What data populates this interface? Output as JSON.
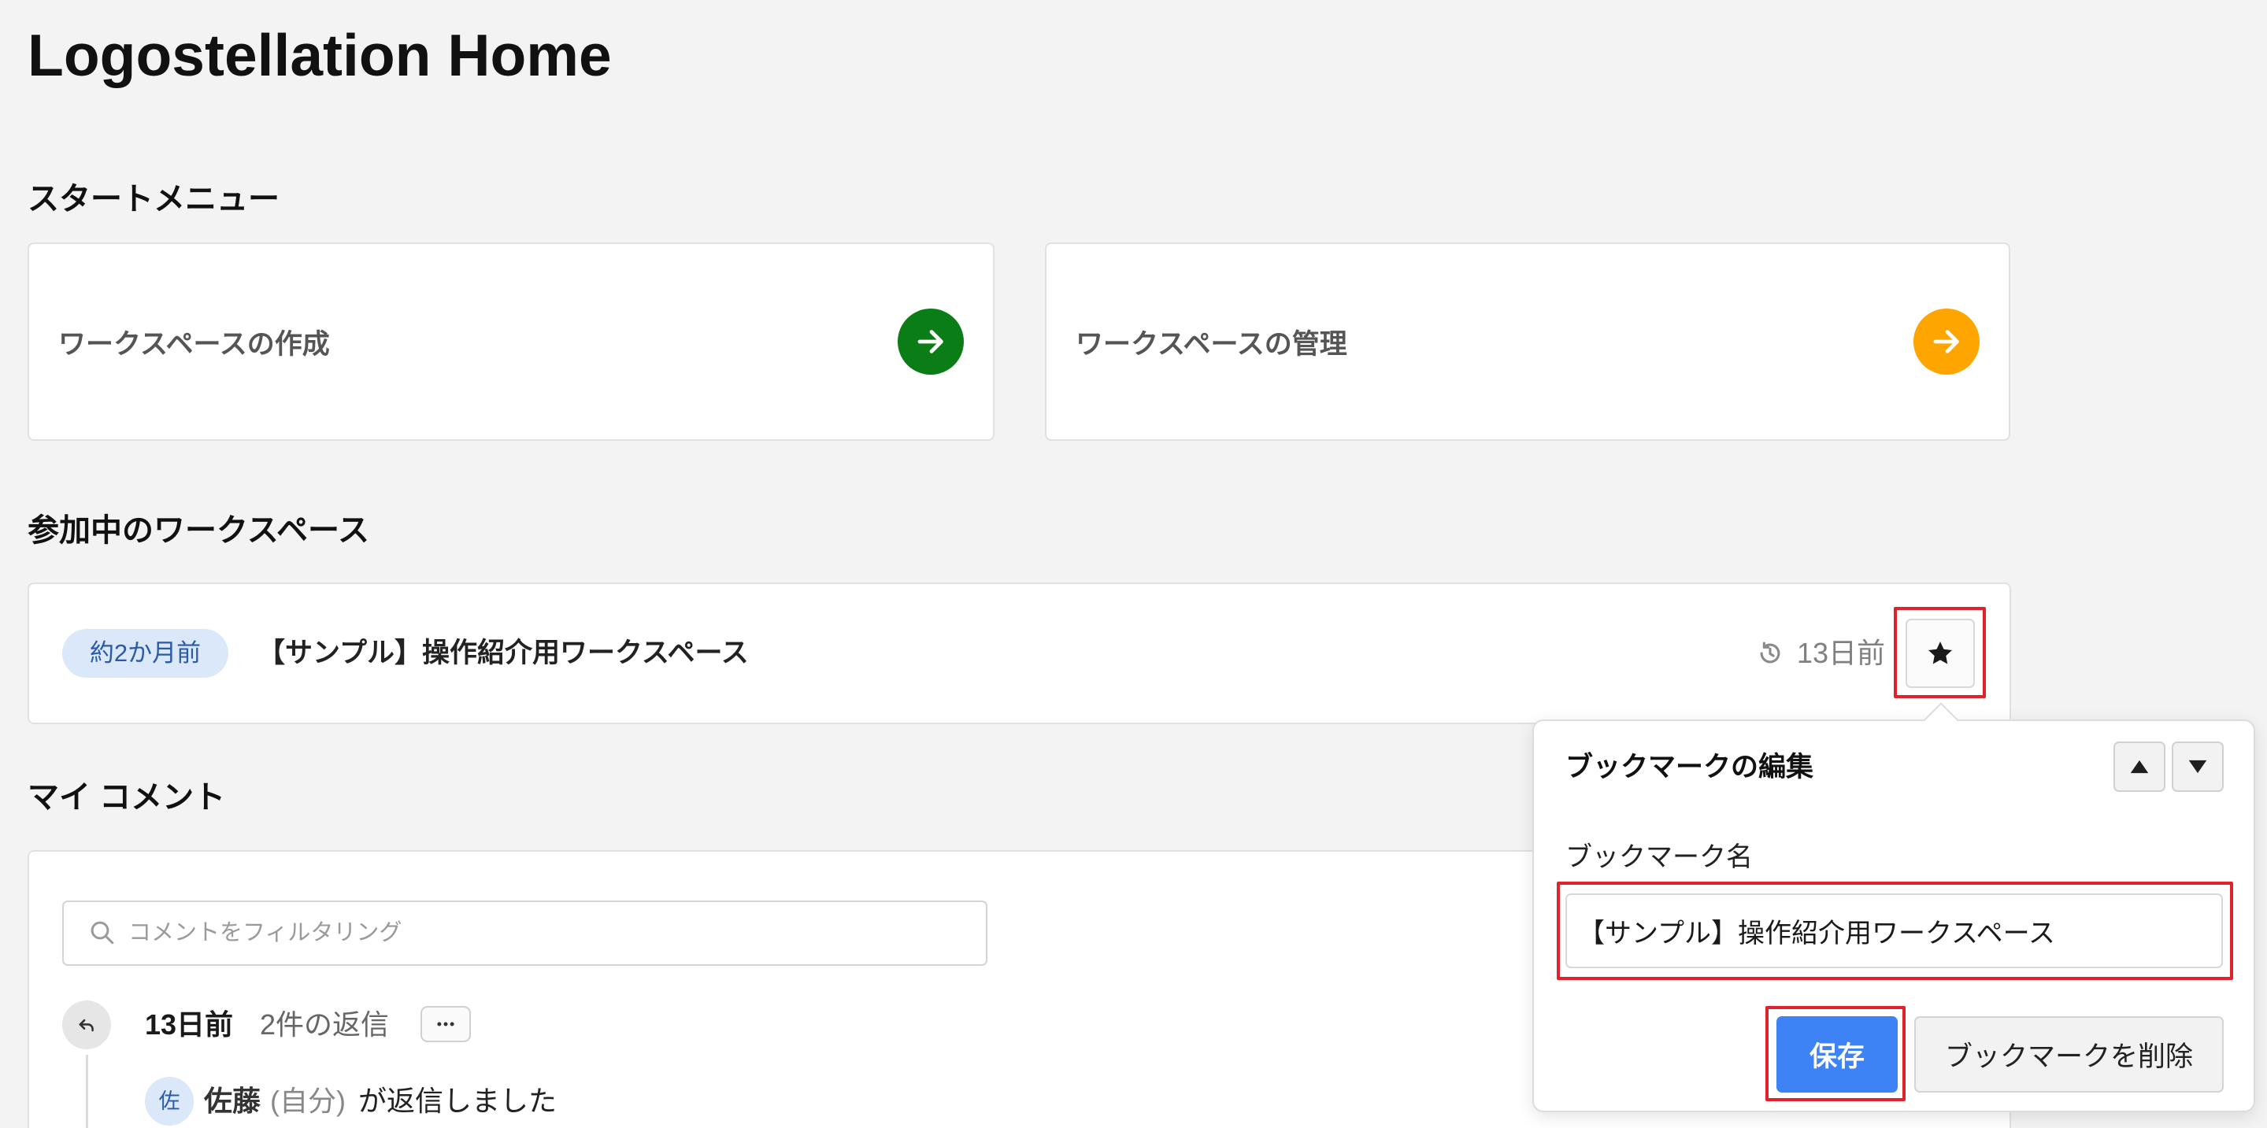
{
  "page": {
    "title": "Logostellation Home"
  },
  "start_menu": {
    "heading": "スタートメニュー",
    "cards": [
      {
        "label": "ワークスペースの作成",
        "icon": "arrow-right-icon",
        "accent": "#0b7d16"
      },
      {
        "label": "ワークスペースの管理",
        "icon": "arrow-right-icon",
        "accent": "#ffa500"
      }
    ]
  },
  "joined_workspaces": {
    "heading": "参加中のワークスペース",
    "items": [
      {
        "badge": "約2か月前",
        "name": "【サンプル】操作紹介用ワークスペース",
        "activity_icon": "history-icon",
        "last_activity": "13日前",
        "bookmark_icon": "star-icon",
        "bookmarked": true
      }
    ]
  },
  "my_comments": {
    "heading": "マイ コメント",
    "search": {
      "icon": "search-icon",
      "placeholder": "コメントをフィルタリング"
    },
    "threads": [
      {
        "icon": "reply-icon",
        "time": "13日前",
        "reply_count": "2件の返信",
        "menu_icon": "ellipsis-icon",
        "replies": [
          {
            "avatar": "佐",
            "user": "佐藤",
            "self_tag": "(自分)",
            "action": "が返信しました"
          }
        ]
      }
    ]
  },
  "bookmark_editor": {
    "title": "ブックマークの編集",
    "move_up_icon": "triangle-up-icon",
    "move_down_icon": "triangle-down-icon",
    "name_label": "ブックマーク名",
    "name_value": "【サンプル】操作紹介用ワークスペース",
    "save_label": "保存",
    "delete_label": "ブックマークを削除"
  },
  "colors": {
    "background": "#f3f3f3",
    "badge_bg": "#dbe8fa",
    "badge_text": "#2a5aa8",
    "primary": "#3d83f6",
    "highlight": "#e0222d"
  }
}
